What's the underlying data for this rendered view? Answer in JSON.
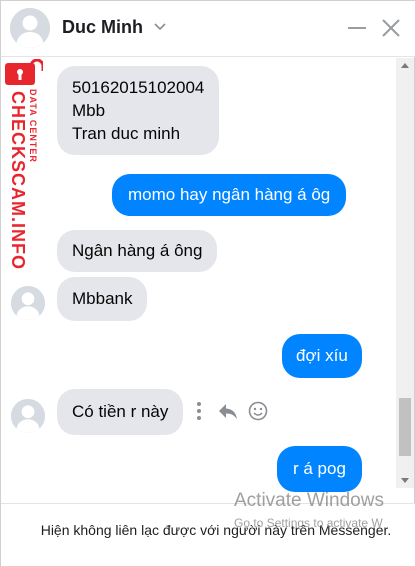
{
  "header": {
    "contact_name": "Duc Minh"
  },
  "messages": [
    {
      "id": "m1",
      "direction": "incoming",
      "lines": [
        "50162015102004",
        "Mbb",
        "Tran duc minh"
      ]
    },
    {
      "id": "m2",
      "direction": "outgoing",
      "text": "momo hay ngân hàng á ôg"
    },
    {
      "id": "m3",
      "direction": "incoming",
      "text": "Ngân hàng á ông"
    },
    {
      "id": "m4",
      "direction": "incoming",
      "text": "Mbbank"
    },
    {
      "id": "m5",
      "direction": "outgoing",
      "text": "đợi xíu"
    },
    {
      "id": "m6",
      "direction": "incoming",
      "text": "Có tiền r này"
    },
    {
      "id": "m7",
      "direction": "outgoing",
      "text": "r á pog"
    }
  ],
  "footer": {
    "notice": "Hiện không liên lạc được với người này trên Messenger."
  },
  "overlay": {
    "activate_title": "Activate Windows",
    "activate_sub": "Go to Settings to activate W"
  },
  "watermark": {
    "brand": "CHECKSCAM.INFO",
    "sub": "DATA CENTER"
  },
  "colors": {
    "accent": "#0084ff",
    "incoming_bubble": "#e4e6eb",
    "watermark_red": "#e8262e"
  }
}
